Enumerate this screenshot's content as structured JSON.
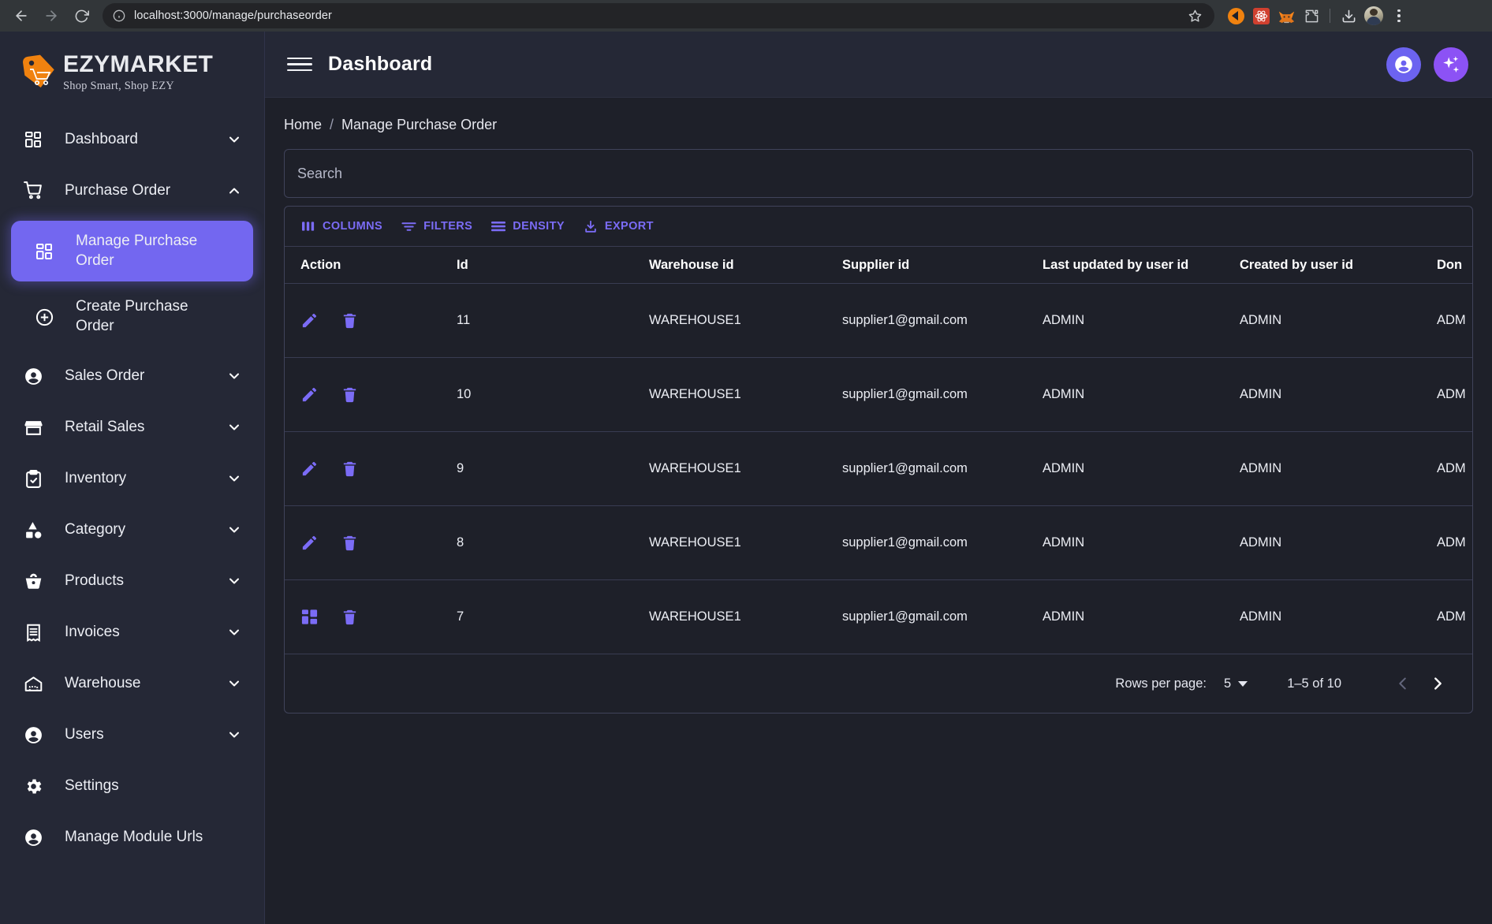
{
  "browser": {
    "url": "localhost:3000/manage/purchaseorder",
    "back_label": "Back",
    "forward_label": "Forward",
    "reload_label": "Reload",
    "bookmark_label": "Bookmark this tab",
    "extensions": [
      {
        "name": "brand-orange-extension-icon"
      },
      {
        "name": "react-devtools-extension-icon"
      },
      {
        "name": "metamask-extension-icon"
      },
      {
        "name": "extensions-puzzle-icon"
      }
    ],
    "downloads_label": "Downloads",
    "profile_label": "Profile",
    "menu_label": "Customize and control"
  },
  "sidebar": {
    "logo": {
      "title": "EZYMARKET",
      "tagline": "Shop Smart, Shop EZY",
      "accent": "#f0820f"
    },
    "items": [
      {
        "label": "Dashboard",
        "icon": "dashboard-grid-icon",
        "chevron": "down",
        "type": "group"
      },
      {
        "label": "Purchase Order",
        "icon": "shopping-cart-icon",
        "chevron": "up",
        "type": "group"
      },
      {
        "label": "Manage Purchase Order",
        "icon": "dashboard-grid-icon",
        "type": "sub",
        "active": true
      },
      {
        "label": "Create Purchase Order",
        "icon": "plus-circle-icon",
        "type": "sub",
        "active": false
      },
      {
        "label": "Sales Order",
        "icon": "person-circle-icon",
        "chevron": "down",
        "type": "group"
      },
      {
        "label": "Retail Sales",
        "icon": "storefront-icon",
        "chevron": "down",
        "type": "group"
      },
      {
        "label": "Inventory",
        "icon": "clipboard-check-icon",
        "chevron": "down",
        "type": "group"
      },
      {
        "label": "Category",
        "icon": "shapes-icon",
        "chevron": "down",
        "type": "group"
      },
      {
        "label": "Products",
        "icon": "basket-icon",
        "chevron": "down",
        "type": "group"
      },
      {
        "label": "Invoices",
        "icon": "receipt-icon",
        "chevron": "down",
        "type": "group"
      },
      {
        "label": "Warehouse",
        "icon": "warehouse-icon",
        "chevron": "down",
        "type": "group"
      },
      {
        "label": "Users",
        "icon": "person-circle-icon",
        "chevron": "down",
        "type": "group"
      },
      {
        "label": "Settings",
        "icon": "gear-icon",
        "chevron": "",
        "type": "group"
      },
      {
        "label": "Manage Module Urls",
        "icon": "person-circle-icon",
        "chevron": "",
        "type": "group"
      }
    ]
  },
  "header": {
    "title": "Dashboard",
    "menu_label": "Toggle navigation",
    "account_label": "Account",
    "ai_label": "AI assistant",
    "account_color": "#6c63f0",
    "ai_color": "#8c52f5"
  },
  "breadcrumb": {
    "home": "Home",
    "separator": "/",
    "current": "Manage Purchase Order"
  },
  "search": {
    "placeholder": "Search",
    "value": ""
  },
  "toolbar": {
    "columns": "COLUMNS",
    "filters": "FILTERS",
    "density": "DENSITY",
    "export": "EXPORT",
    "accent": "#7b6cf6"
  },
  "table": {
    "columns": [
      "Action",
      "Id",
      "Warehouse id",
      "Supplier id",
      "Last updated by user id",
      "Created by user id",
      "Don"
    ],
    "rows": [
      {
        "action": [
          "edit-icon",
          "delete-icon"
        ],
        "id": "11",
        "warehouse": "WAREHOUSE1",
        "supplier": "supplier1@gmail.com",
        "updated_by": "ADMIN",
        "created_by": "ADMIN",
        "done_by": "ADM"
      },
      {
        "action": [
          "edit-icon",
          "delete-icon"
        ],
        "id": "10",
        "warehouse": "WAREHOUSE1",
        "supplier": "supplier1@gmail.com",
        "updated_by": "ADMIN",
        "created_by": "ADMIN",
        "done_by": "ADM"
      },
      {
        "action": [
          "edit-icon",
          "delete-icon"
        ],
        "id": "9",
        "warehouse": "WAREHOUSE1",
        "supplier": "supplier1@gmail.com",
        "updated_by": "ADMIN",
        "created_by": "ADMIN",
        "done_by": "ADM"
      },
      {
        "action": [
          "edit-icon",
          "delete-icon"
        ],
        "id": "8",
        "warehouse": "WAREHOUSE1",
        "supplier": "supplier1@gmail.com",
        "updated_by": "ADMIN",
        "created_by": "ADMIN",
        "done_by": "ADM"
      },
      {
        "action": [
          "grid-icon",
          "delete-icon"
        ],
        "id": "7",
        "warehouse": "WAREHOUSE1",
        "supplier": "supplier1@gmail.com",
        "updated_by": "ADMIN",
        "created_by": "ADMIN",
        "done_by": "ADM"
      }
    ]
  },
  "pagination": {
    "rows_per_page_label": "Rows per page:",
    "rows_per_page_value": "5",
    "range": "1–5 of 10",
    "prev_label": "Previous page",
    "next_label": "Next page",
    "prev_enabled": false,
    "next_enabled": true
  }
}
